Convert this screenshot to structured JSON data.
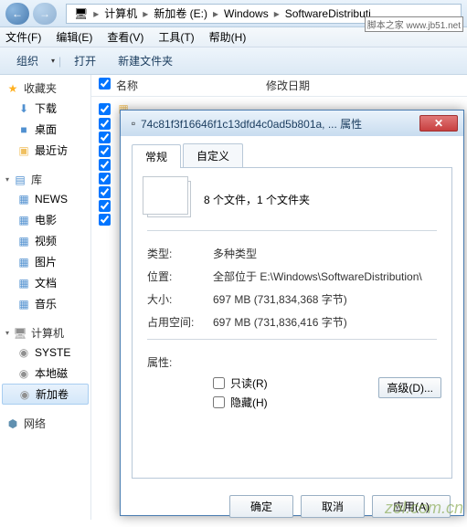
{
  "nav": {
    "back_icon": "←",
    "fwd_icon": "→"
  },
  "breadcrumb": {
    "root_icon": "🖥",
    "items": [
      "计算机",
      "新加卷 (E:)",
      "Windows",
      "SoftwareDistributi"
    ]
  },
  "menubar": {
    "file": "文件(F)",
    "edit": "编辑(E)",
    "view": "查看(V)",
    "tools": "工具(T)",
    "help": "帮助(H)"
  },
  "toolbar": {
    "organize": "组织",
    "open": "打开",
    "newfolder": "新建文件夹"
  },
  "columns": {
    "name": "名称",
    "date": "修改日期"
  },
  "sidebar": {
    "fav": {
      "label": "收藏夹",
      "items": [
        "下载",
        "桌面",
        "最近访"
      ]
    },
    "lib": {
      "label": "库",
      "items": [
        "NEWS",
        "电影",
        "视频",
        "图片",
        "文档",
        "音乐"
      ]
    },
    "computer": {
      "label": "计算机",
      "items": [
        "SYSTE",
        "本地磁",
        "新加卷"
      ]
    },
    "network": {
      "label": "网络"
    }
  },
  "dialog": {
    "title": "74c81f3f16646f1c13dfd4c0ad5b801a, ... 属性",
    "tabs": {
      "general": "常规",
      "custom": "自定义"
    },
    "summary": "8 个文件，1 个文件夹",
    "type_label": "类型:",
    "type_val": "多种类型",
    "location_label": "位置:",
    "location_val": "全部位于 E:\\Windows\\SoftwareDistribution\\",
    "size_label": "大小:",
    "size_val": "697 MB (731,834,368 字节)",
    "disk_label": "占用空间:",
    "disk_val": "697 MB (731,836,416 字节)",
    "attr_label": "属性:",
    "readonly": "只读(R)",
    "hidden": "隐藏(H)",
    "advanced": "高级(D)...",
    "ok": "确定",
    "cancel": "取消",
    "apply": "应用(A)"
  },
  "watermark": {
    "top": "脚本之家\nwww.jb51.net",
    "bottom": "zol.com.cn"
  }
}
